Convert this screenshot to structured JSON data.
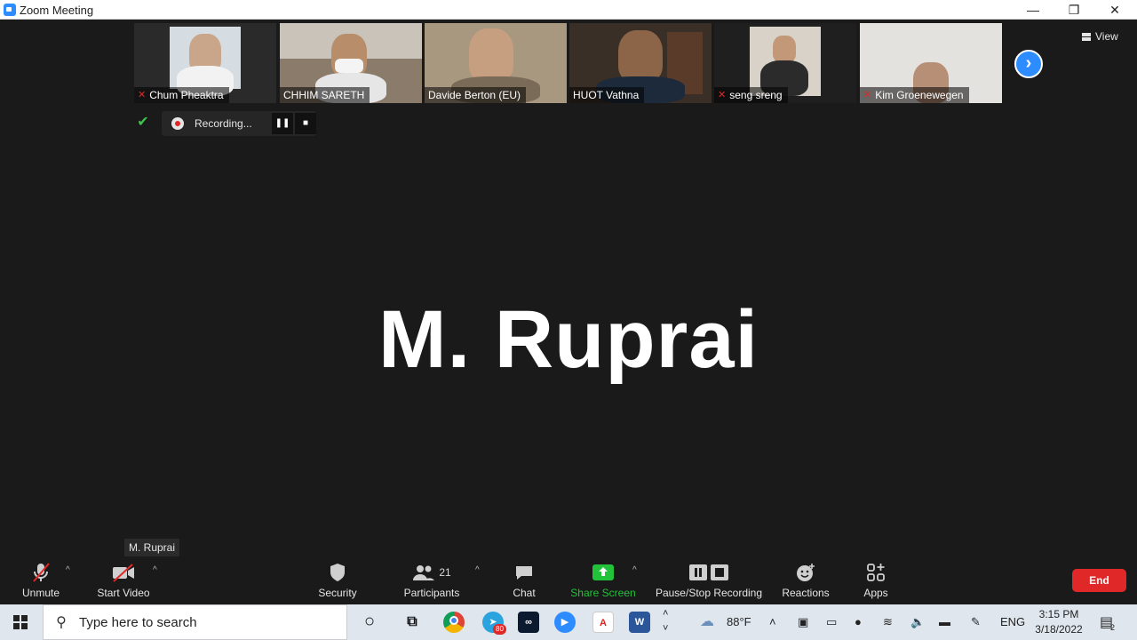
{
  "window": {
    "title": "Zoom Meeting",
    "minimize": "—",
    "restore": "❐",
    "close": "✕"
  },
  "view_label": "View",
  "participants_strip": [
    {
      "name": "Chum Pheaktra",
      "muted": true,
      "bg": "#cfd6dc"
    },
    {
      "name": "CHHIM SARETH",
      "muted": false,
      "bg": "#8a7b6a"
    },
    {
      "name": "Davide Berton (EU)",
      "muted": false,
      "bg": "#a99880"
    },
    {
      "name": "HUOT Vathna",
      "muted": false,
      "bg": "#3a2f26"
    },
    {
      "name": "seng sreng",
      "muted": true,
      "bg": "#1f1f1f"
    },
    {
      "name": "Kim Groenewegen",
      "muted": true,
      "bg": "#e4e2de"
    }
  ],
  "recording": {
    "text": "Recording...",
    "pause_icon": "❚❚",
    "stop_icon": "■"
  },
  "active_speaker": "M. Ruprai",
  "tooltip": "M. Ruprai",
  "controls": {
    "unmute": "Unmute",
    "start_video": "Start Video",
    "security": "Security",
    "participants": "Participants",
    "participants_count": "21",
    "chat": "Chat",
    "share_screen": "Share Screen",
    "pause_stop_recording": "Pause/Stop Recording",
    "reactions": "Reactions",
    "apps": "Apps",
    "end": "End"
  },
  "colors": {
    "zoom_blue": "#2d8cff",
    "end_red": "#e02828",
    "share_green": "#22c33a"
  },
  "taskbar": {
    "search_placeholder": "Type here to search",
    "telegram_badge": "80",
    "weather": "88°F",
    "language": "ENG",
    "time": "3:15 PM",
    "date": "3/18/2022",
    "notifications": "2"
  }
}
